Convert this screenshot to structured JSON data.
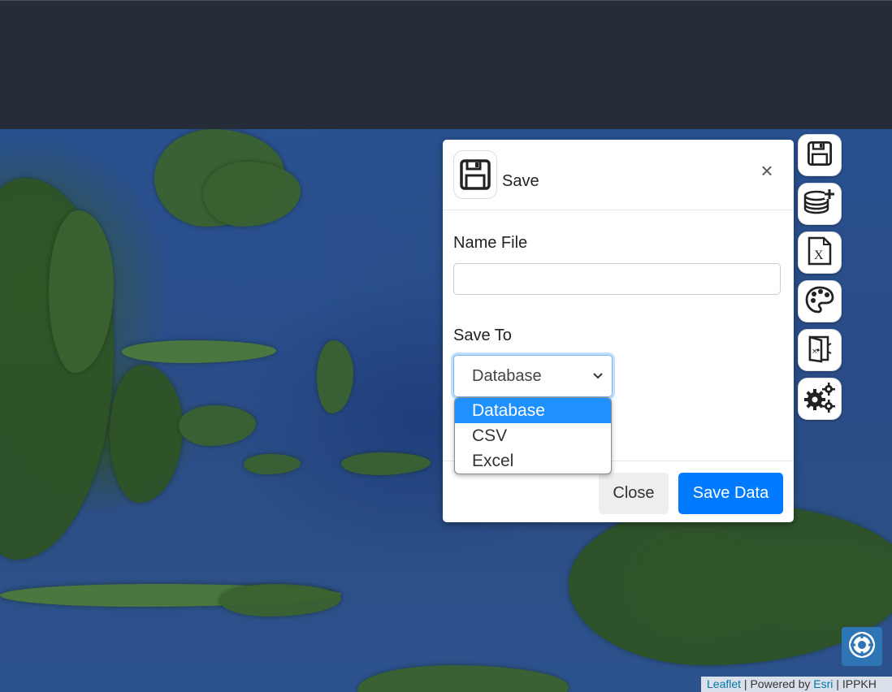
{
  "modal": {
    "title": "Save",
    "close_symbol": "×",
    "name_label": "Name File",
    "name_value": "",
    "saveto_label": "Save To",
    "select_value": "Database",
    "options": [
      "Database",
      "CSV",
      "Excel"
    ],
    "selected_option": "Database",
    "close_button": "Close",
    "save_button": "Save Data",
    "header_icon": "floppy-disk-icon"
  },
  "toolbar": {
    "items": [
      {
        "icon": "floppy-disk-icon"
      },
      {
        "icon": "database-add-icon"
      },
      {
        "icon": "excel-file-icon"
      },
      {
        "icon": "palette-icon"
      },
      {
        "icon": "map-door-icon"
      },
      {
        "icon": "gears-icon"
      }
    ]
  },
  "map": {
    "locate_icon": "locate-icon"
  },
  "attribution": {
    "leaflet": "Leaflet",
    "sep1": " | Powered by ",
    "esri": "Esri",
    "sep2": " | IPPKH"
  },
  "colors": {
    "primary": "#007bff",
    "topbar": "#262d39",
    "selected_option": "#1e90ff"
  }
}
